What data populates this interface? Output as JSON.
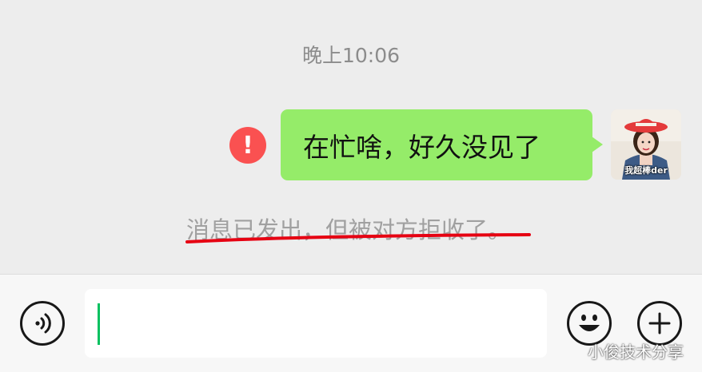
{
  "chat": {
    "timestamp": "晚上10:06",
    "message": {
      "text": "在忙啥，好久没见了",
      "status_icon": "!",
      "bubble_color": "#95ec69"
    },
    "avatar": {
      "caption": "我超棒der",
      "icon": "avatar-girl-red-hat"
    },
    "system_notice": "消息已发出，但被对方拒收了。"
  },
  "input_bar": {
    "voice_icon": "voice-icon",
    "input_value": "",
    "emoji_icon": "emoji-icon",
    "add_icon": "plus-icon"
  },
  "watermark": "小俊技术分享",
  "colors": {
    "error": "#fa5151",
    "underline": "#e60012",
    "caret": "#07c160"
  }
}
